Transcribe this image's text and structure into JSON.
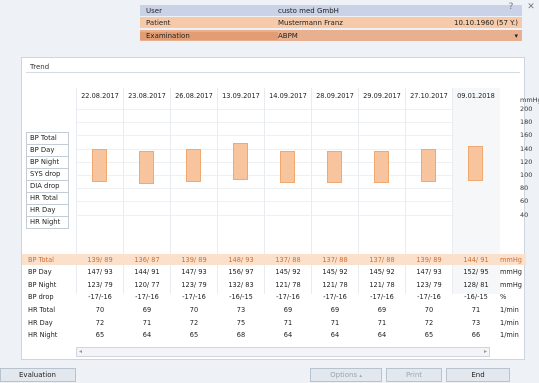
{
  "header": {
    "user_label": "User",
    "user_value": "custo med GmbH",
    "patient_label": "Patient",
    "patient_value": "Mustermann Franz",
    "patient_dob": "10.10.1960 (57 Y.)",
    "exam_label": "Examination",
    "exam_value": "ABPM",
    "help_glyph": "?",
    "close_glyph": "✕"
  },
  "panel": {
    "title": "Trend"
  },
  "chart_data": {
    "type": "bar",
    "categories": [
      "22.08.2017",
      "23.08.2017",
      "26.08.2017",
      "13.09.2017",
      "14.09.2017",
      "28.09.2017",
      "29.09.2017",
      "27.10.2017",
      "09.01.2018"
    ],
    "series": [
      {
        "name": "BP Total",
        "low": [
          89,
          87,
          89,
          93,
          88,
          88,
          88,
          89,
          91
        ],
        "high": [
          139,
          136,
          139,
          148,
          137,
          137,
          137,
          139,
          144
        ]
      }
    ],
    "ylabel": "mmHg",
    "yticks": [
      "200",
      "180",
      "160",
      "140",
      "120",
      "100",
      "80",
      "60",
      "40"
    ],
    "ylim": [
      40,
      200
    ],
    "grid": true
  },
  "row_labels": [
    "BP Total",
    "BP Day",
    "BP Night",
    "SYS drop",
    "DIA drop",
    "HR Total",
    "HR Day",
    "HR Night"
  ],
  "table": [
    {
      "label": "BP Total",
      "values": [
        "139/ 89",
        "136/ 87",
        "139/ 89",
        "148/ 93",
        "137/ 88",
        "137/ 88",
        "137/ 88",
        "139/ 89",
        "144/ 91"
      ],
      "unit": "mmHg",
      "highlight": true
    },
    {
      "label": "BP Day",
      "values": [
        "147/ 93",
        "144/ 91",
        "147/ 93",
        "156/ 97",
        "145/ 92",
        "145/ 92",
        "145/ 92",
        "147/ 93",
        "152/ 95"
      ],
      "unit": "mmHg"
    },
    {
      "label": "BP Night",
      "values": [
        "123/ 79",
        "120/ 77",
        "123/ 79",
        "132/ 83",
        "121/ 78",
        "121/ 78",
        "121/ 78",
        "123/ 79",
        "128/ 81"
      ],
      "unit": "mmHg"
    },
    {
      "label": "BP drop",
      "values": [
        "-17/-16",
        "-17/-16",
        "-17/-16",
        "-16/-15",
        "-17/-16",
        "-17/-16",
        "-17/-16",
        "-17/-16",
        "-16/-15"
      ],
      "unit": "%"
    },
    {
      "label": "HR Total",
      "values": [
        "70",
        "69",
        "70",
        "73",
        "69",
        "69",
        "69",
        "70",
        "71"
      ],
      "unit": "1/min"
    },
    {
      "label": "HR Day",
      "values": [
        "72",
        "71",
        "72",
        "75",
        "71",
        "71",
        "71",
        "72",
        "73"
      ],
      "unit": "1/min"
    },
    {
      "label": "HR Night",
      "values": [
        "65",
        "64",
        "65",
        "68",
        "64",
        "64",
        "64",
        "65",
        "66"
      ],
      "unit": "1/min"
    }
  ],
  "buttons": {
    "evaluation": "Evaluation",
    "options": "Options",
    "print": "Print",
    "end": "End"
  },
  "colors": {
    "accent_orange": "#f8c49d",
    "highlight_row": "#fbe0cc",
    "patient_row": "#f6c9a8",
    "user_row": "#c9d2e6",
    "exam_row": "#e39d73",
    "highlight_text": "#d07030"
  }
}
